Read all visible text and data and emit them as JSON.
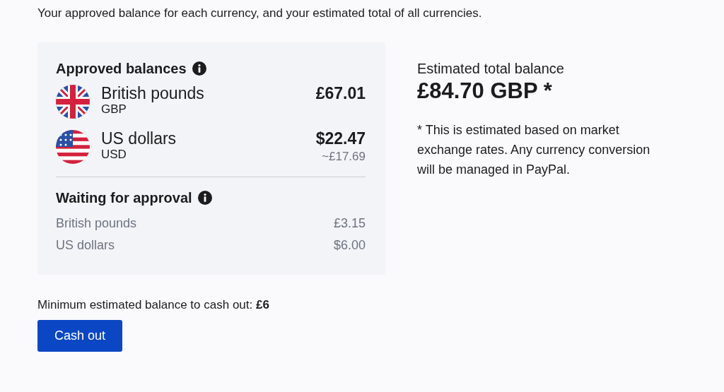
{
  "intro": "Your approved balance for each currency, and your estimated total of all currencies.",
  "approved": {
    "title": "Approved balances",
    "items": [
      {
        "kind": "gb",
        "name": "British pounds",
        "code": "GBP",
        "amount": "£67.01"
      },
      {
        "kind": "us",
        "name": "US dollars",
        "code": "USD",
        "amount": "$22.47",
        "converted": "~£17.69"
      }
    ]
  },
  "waiting": {
    "title": "Waiting for approval",
    "items": [
      {
        "name": "British pounds",
        "amount": "£3.15"
      },
      {
        "name": "US dollars",
        "amount": "$6.00"
      }
    ]
  },
  "total": {
    "label": "Estimated total balance",
    "amount": "£84.70 GBP *",
    "note": "* This is estimated based on market exchange rates. Any currency conversion will be managed in PayPal."
  },
  "minimum": "Minimum estimated balance to cash out: **£6**",
  "button": "Cash out"
}
